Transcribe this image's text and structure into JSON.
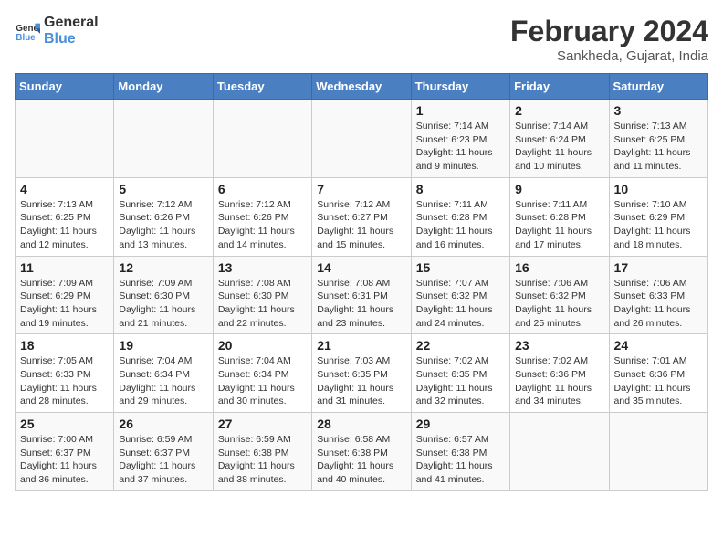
{
  "logo": {
    "line1": "General",
    "line2": "Blue"
  },
  "title": "February 2024",
  "location": "Sankheda, Gujarat, India",
  "days_of_week": [
    "Sunday",
    "Monday",
    "Tuesday",
    "Wednesday",
    "Thursday",
    "Friday",
    "Saturday"
  ],
  "weeks": [
    [
      {
        "day": "",
        "info": ""
      },
      {
        "day": "",
        "info": ""
      },
      {
        "day": "",
        "info": ""
      },
      {
        "day": "",
        "info": ""
      },
      {
        "day": "1",
        "info": "Sunrise: 7:14 AM\nSunset: 6:23 PM\nDaylight: 11 hours and 9 minutes."
      },
      {
        "day": "2",
        "info": "Sunrise: 7:14 AM\nSunset: 6:24 PM\nDaylight: 11 hours and 10 minutes."
      },
      {
        "day": "3",
        "info": "Sunrise: 7:13 AM\nSunset: 6:25 PM\nDaylight: 11 hours and 11 minutes."
      }
    ],
    [
      {
        "day": "4",
        "info": "Sunrise: 7:13 AM\nSunset: 6:25 PM\nDaylight: 11 hours and 12 minutes."
      },
      {
        "day": "5",
        "info": "Sunrise: 7:12 AM\nSunset: 6:26 PM\nDaylight: 11 hours and 13 minutes."
      },
      {
        "day": "6",
        "info": "Sunrise: 7:12 AM\nSunset: 6:26 PM\nDaylight: 11 hours and 14 minutes."
      },
      {
        "day": "7",
        "info": "Sunrise: 7:12 AM\nSunset: 6:27 PM\nDaylight: 11 hours and 15 minutes."
      },
      {
        "day": "8",
        "info": "Sunrise: 7:11 AM\nSunset: 6:28 PM\nDaylight: 11 hours and 16 minutes."
      },
      {
        "day": "9",
        "info": "Sunrise: 7:11 AM\nSunset: 6:28 PM\nDaylight: 11 hours and 17 minutes."
      },
      {
        "day": "10",
        "info": "Sunrise: 7:10 AM\nSunset: 6:29 PM\nDaylight: 11 hours and 18 minutes."
      }
    ],
    [
      {
        "day": "11",
        "info": "Sunrise: 7:09 AM\nSunset: 6:29 PM\nDaylight: 11 hours and 19 minutes."
      },
      {
        "day": "12",
        "info": "Sunrise: 7:09 AM\nSunset: 6:30 PM\nDaylight: 11 hours and 21 minutes."
      },
      {
        "day": "13",
        "info": "Sunrise: 7:08 AM\nSunset: 6:30 PM\nDaylight: 11 hours and 22 minutes."
      },
      {
        "day": "14",
        "info": "Sunrise: 7:08 AM\nSunset: 6:31 PM\nDaylight: 11 hours and 23 minutes."
      },
      {
        "day": "15",
        "info": "Sunrise: 7:07 AM\nSunset: 6:32 PM\nDaylight: 11 hours and 24 minutes."
      },
      {
        "day": "16",
        "info": "Sunrise: 7:06 AM\nSunset: 6:32 PM\nDaylight: 11 hours and 25 minutes."
      },
      {
        "day": "17",
        "info": "Sunrise: 7:06 AM\nSunset: 6:33 PM\nDaylight: 11 hours and 26 minutes."
      }
    ],
    [
      {
        "day": "18",
        "info": "Sunrise: 7:05 AM\nSunset: 6:33 PM\nDaylight: 11 hours and 28 minutes."
      },
      {
        "day": "19",
        "info": "Sunrise: 7:04 AM\nSunset: 6:34 PM\nDaylight: 11 hours and 29 minutes."
      },
      {
        "day": "20",
        "info": "Sunrise: 7:04 AM\nSunset: 6:34 PM\nDaylight: 11 hours and 30 minutes."
      },
      {
        "day": "21",
        "info": "Sunrise: 7:03 AM\nSunset: 6:35 PM\nDaylight: 11 hours and 31 minutes."
      },
      {
        "day": "22",
        "info": "Sunrise: 7:02 AM\nSunset: 6:35 PM\nDaylight: 11 hours and 32 minutes."
      },
      {
        "day": "23",
        "info": "Sunrise: 7:02 AM\nSunset: 6:36 PM\nDaylight: 11 hours and 34 minutes."
      },
      {
        "day": "24",
        "info": "Sunrise: 7:01 AM\nSunset: 6:36 PM\nDaylight: 11 hours and 35 minutes."
      }
    ],
    [
      {
        "day": "25",
        "info": "Sunrise: 7:00 AM\nSunset: 6:37 PM\nDaylight: 11 hours and 36 minutes."
      },
      {
        "day": "26",
        "info": "Sunrise: 6:59 AM\nSunset: 6:37 PM\nDaylight: 11 hours and 37 minutes."
      },
      {
        "day": "27",
        "info": "Sunrise: 6:59 AM\nSunset: 6:38 PM\nDaylight: 11 hours and 38 minutes."
      },
      {
        "day": "28",
        "info": "Sunrise: 6:58 AM\nSunset: 6:38 PM\nDaylight: 11 hours and 40 minutes."
      },
      {
        "day": "29",
        "info": "Sunrise: 6:57 AM\nSunset: 6:38 PM\nDaylight: 11 hours and 41 minutes."
      },
      {
        "day": "",
        "info": ""
      },
      {
        "day": "",
        "info": ""
      }
    ]
  ]
}
